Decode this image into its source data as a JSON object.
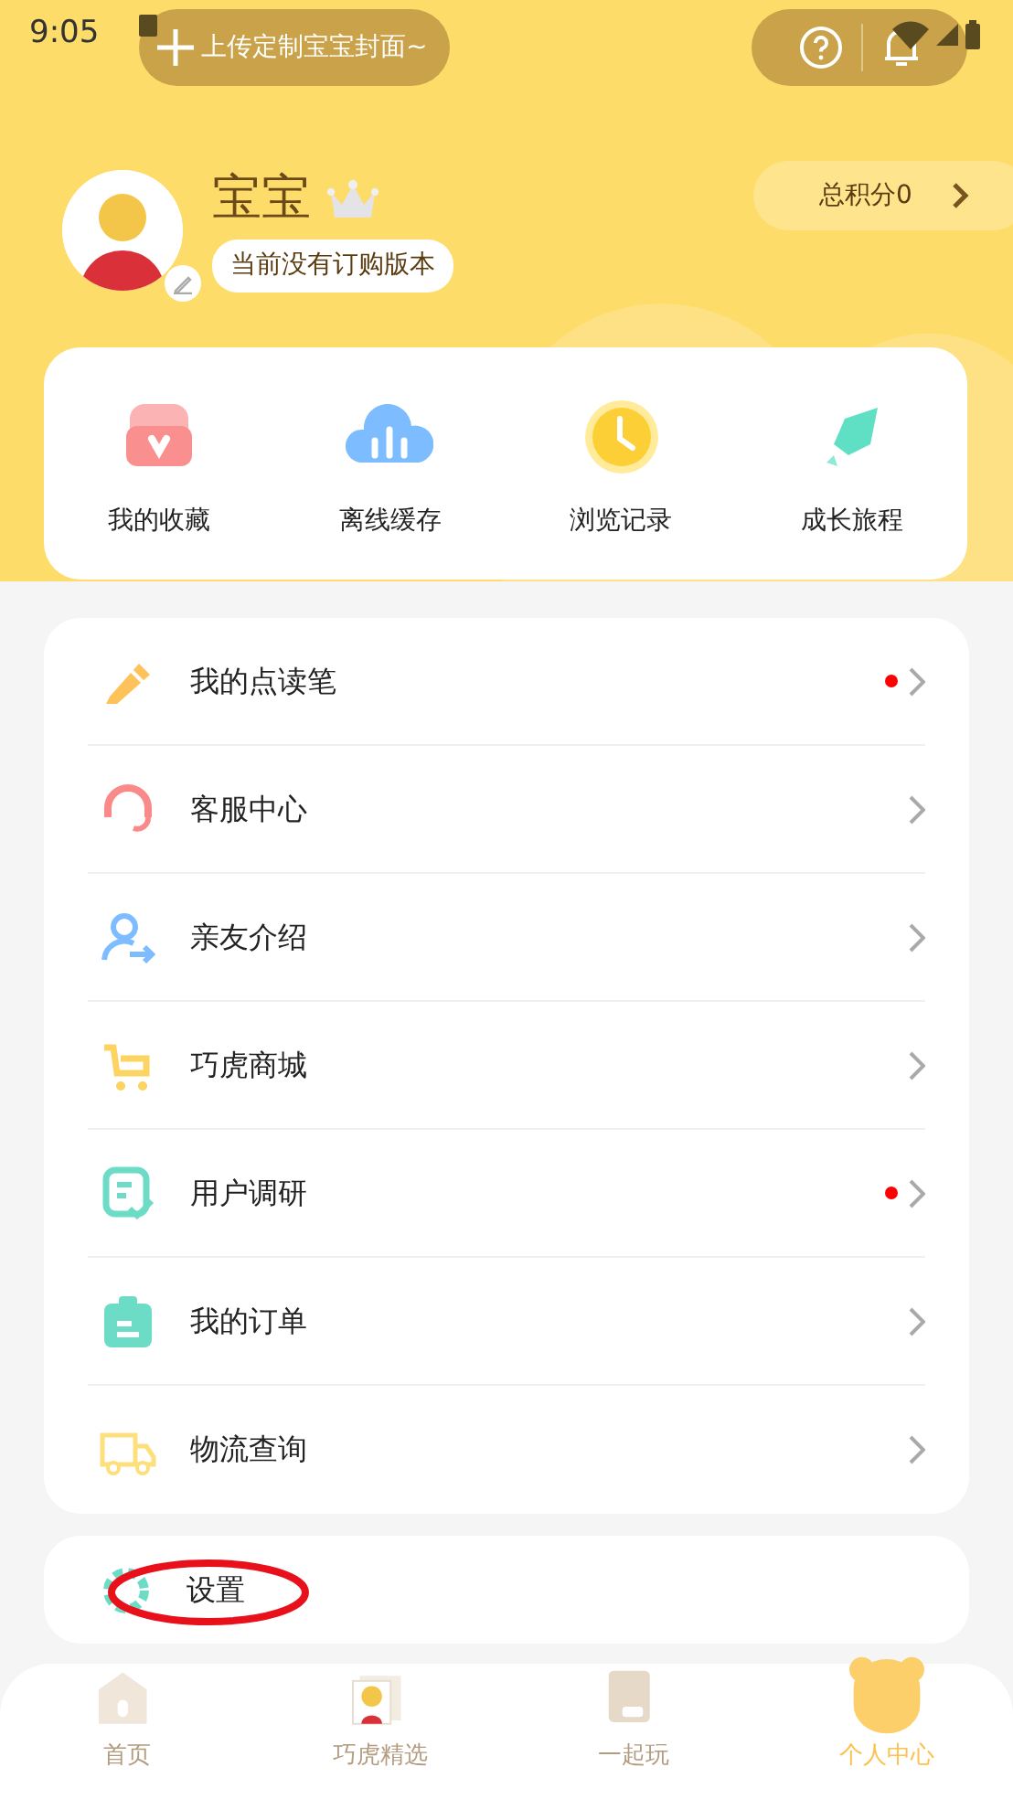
{
  "status_bar": {
    "time": "9:05"
  },
  "header": {
    "upload_label": "上传定制宝宝封面~"
  },
  "profile": {
    "name": "宝宝",
    "subscription": "当前没有订购版本",
    "points": "总积分0"
  },
  "shortcuts": [
    {
      "label": "我的收藏"
    },
    {
      "label": "离线缓存"
    },
    {
      "label": "浏览记录"
    },
    {
      "label": "成长旅程"
    }
  ],
  "menu": [
    {
      "label": "我的点读笔",
      "unread": true
    },
    {
      "label": "客服中心",
      "unread": false
    },
    {
      "label": "亲友介绍",
      "unread": false
    },
    {
      "label": "巧虎商城",
      "unread": false
    },
    {
      "label": "用户调研",
      "unread": true
    },
    {
      "label": "我的订单",
      "unread": false
    },
    {
      "label": "物流查询",
      "unread": false
    }
  ],
  "settings": {
    "label": "设置",
    "circled": true
  },
  "tabs": [
    {
      "label": "首页",
      "selected": false
    },
    {
      "label": "巧虎精选",
      "selected": false
    },
    {
      "label": "一起玩",
      "selected": false
    },
    {
      "label": "个人中心",
      "selected": true
    }
  ]
}
